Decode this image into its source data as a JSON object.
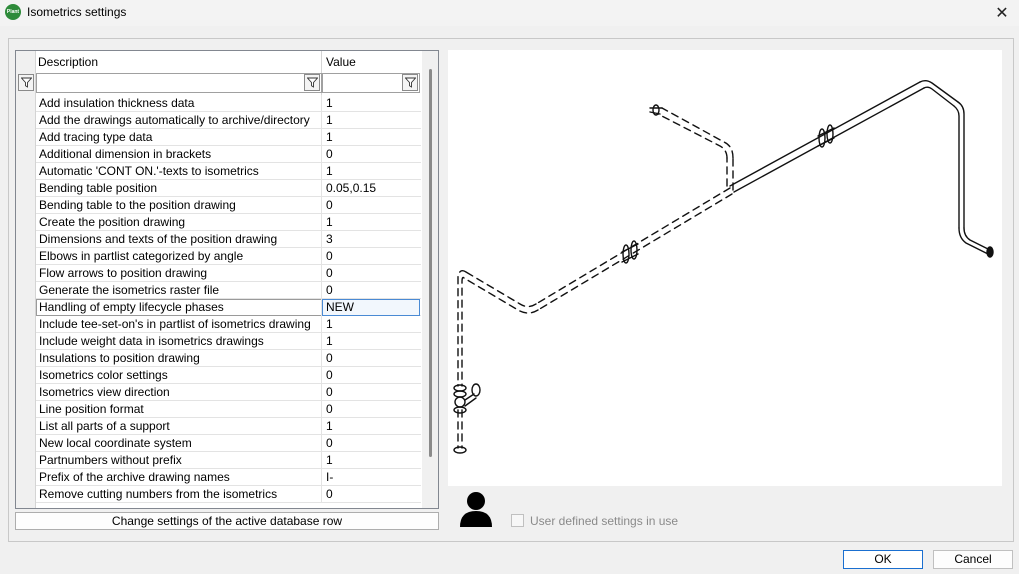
{
  "window": {
    "title": "Isometrics settings",
    "icon_text": "Plant",
    "close_glyph": "✕"
  },
  "grid": {
    "columns": {
      "description": "Description",
      "value": "Value"
    },
    "rows": [
      {
        "description": "Add insulation thickness data",
        "value": "1"
      },
      {
        "description": "Add the drawings automatically to archive/directory",
        "value": "1"
      },
      {
        "description": "Add tracing type data",
        "value": "1"
      },
      {
        "description": "Additional dimension in brackets",
        "value": "0"
      },
      {
        "description": "Automatic 'CONT ON.'-texts to isometrics",
        "value": "1"
      },
      {
        "description": "Bending table position",
        "value": "0.05,0.15"
      },
      {
        "description": "Bending table to the position drawing",
        "value": "0"
      },
      {
        "description": "Create the position drawing",
        "value": "1"
      },
      {
        "description": "Dimensions and texts of the position drawing",
        "value": "3"
      },
      {
        "description": "Elbows in partlist categorized by angle",
        "value": "0"
      },
      {
        "description": "Flow arrows to position drawing",
        "value": "0"
      },
      {
        "description": "Generate the isometrics raster file",
        "value": "0"
      },
      {
        "description": "Handling of empty lifecycle phases",
        "value": "NEW",
        "selected": true
      },
      {
        "description": "Include tee-set-on's in partlist of isometrics drawing",
        "value": "1"
      },
      {
        "description": "Include weight data in isometrics drawings",
        "value": "1"
      },
      {
        "description": "Insulations to position drawing",
        "value": "0"
      },
      {
        "description": "Isometrics color settings",
        "value": "0"
      },
      {
        "description": "Isometrics view direction",
        "value": "0"
      },
      {
        "description": "Line position format",
        "value": "0"
      },
      {
        "description": "List all parts of a support",
        "value": "1"
      },
      {
        "description": "New local coordinate system",
        "value": "0"
      },
      {
        "description": "Partnumbers without prefix",
        "value": "1"
      },
      {
        "description": "Prefix of the archive drawing names",
        "value": "I-"
      },
      {
        "description": "Remove cutting numbers from the isometrics",
        "value": "0"
      }
    ]
  },
  "buttons": {
    "change": "Change settings of the active database row",
    "ok": "OK",
    "cancel": "Cancel"
  },
  "user_settings": {
    "label": "User defined settings in use",
    "checked": false,
    "icon": "user-icon"
  },
  "icons": {
    "filter": "filter-icon",
    "close": "close-icon"
  }
}
